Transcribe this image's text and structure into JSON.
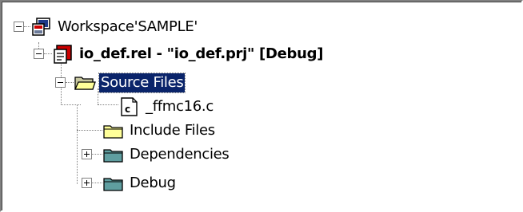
{
  "tree": {
    "workspace": {
      "label": "Workspace'SAMPLE'",
      "expanded": true
    },
    "project": {
      "label": "io_def.rel - \"io_def.prj\" [Debug]",
      "expanded": true
    },
    "source_files": {
      "label": "Source Files",
      "expanded": true,
      "selected": true
    },
    "file_ffmc16": {
      "label": "_ffmc16.c"
    },
    "include_files": {
      "label": "Include Files"
    },
    "dependencies": {
      "label": "Dependencies",
      "expanded": false
    },
    "debug": {
      "label": "Debug",
      "expanded": false
    }
  },
  "colors": {
    "selection": "#0a246a",
    "folder_yellow": "#ffff99",
    "folder_teal": "#5f9ea0",
    "project_red": "#cc0000"
  }
}
